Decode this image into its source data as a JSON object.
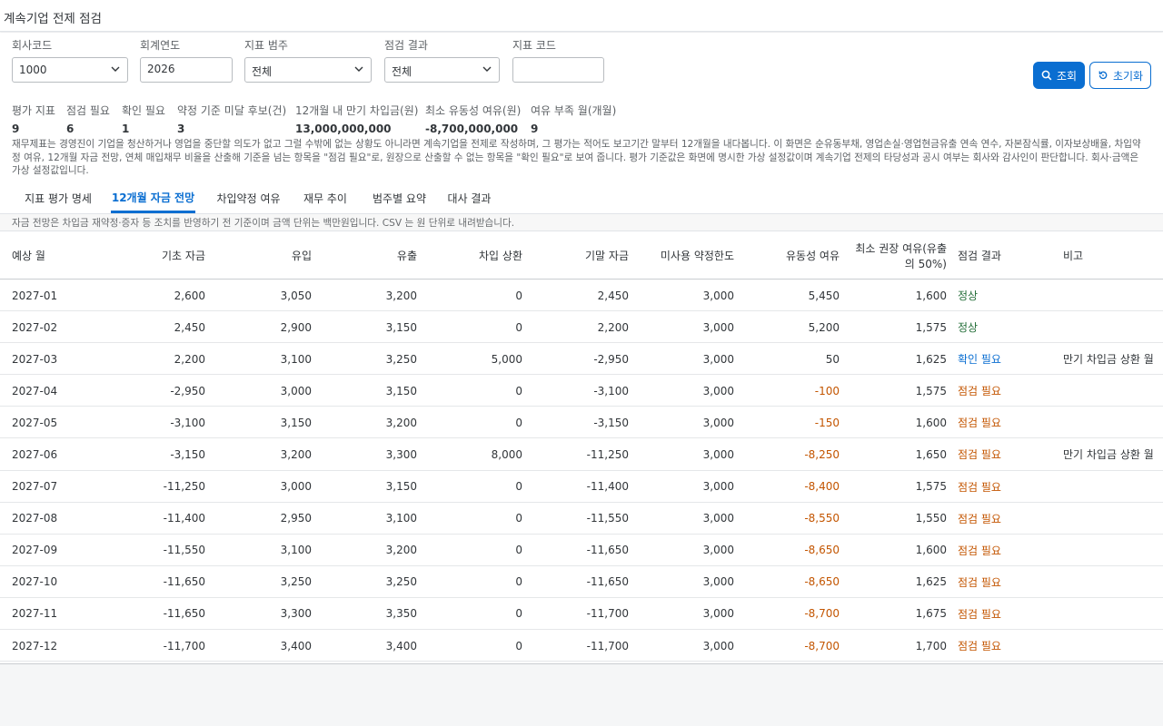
{
  "app_title": "계속기업 전제 점검",
  "filters": {
    "company_code": {
      "label": "회사코드",
      "value": "1000"
    },
    "fiscal_year": {
      "label": "회계연도",
      "value": "2026"
    },
    "indicator_category": {
      "label": "지표 범주",
      "value": "전체"
    },
    "check_result": {
      "label": "점검 결과",
      "value": "전체"
    },
    "indicator_code": {
      "label": "지표 코드",
      "value": ""
    }
  },
  "buttons": {
    "search": "조회",
    "reset": "초기화"
  },
  "kpis": [
    {
      "label": "평가 지표",
      "value": "9"
    },
    {
      "label": "점검 필요",
      "value": "6"
    },
    {
      "label": "확인 필요",
      "value": "1"
    },
    {
      "label": "약정 기준 미달 후보(건)",
      "value": "3"
    },
    {
      "label": "12개월 내 만기 차입금(원)",
      "value": "13,000,000,000"
    },
    {
      "label": "최소 유동성 여유(원)",
      "value": "-8,700,000,000"
    },
    {
      "label": "여유 부족 월(개월)",
      "value": "9"
    }
  ],
  "description": "재무제표는 경영진이 기업을 청산하거나 영업을 중단할 의도가 없고 그럴 수밖에 없는 상황도 아니라면 계속기업을 전제로 작성하며, 그 평가는 적어도 보고기간 말부터 12개월을 내다봅니다. 이 화면은 순유동부채, 영업손실·영업현금유출 연속 연수, 자본잠식률, 이자보상배율, 차입약정 여유, 12개월 자금 전망, 연체 매입채무 비율을 산출해 기준을 넘는 항목을 \"점검 필요\"로, 원장으로 산출할 수 없는 항목을 \"확인 필요\"로 보여 줍니다. 평가 기준값은 화면에 명시한 가상 설정값이며 계속기업 전제의 타당성과 공시 여부는 회사와 감사인이 판단합니다. 회사·금액은 가상 설정값입니다.",
  "tabs": [
    "지표 평가 명세",
    "12개월 자금 전망",
    "차입약정 여유",
    "재무 추이",
    "범주별 요약",
    "대사 결과"
  ],
  "active_tab": 1,
  "table_note": "자금 전망은 차입금 재약정·증자 등 조치를 반영하기 전 기준이며 금액 단위는 백만원입니다. CSV 는 원 단위로 내려받습니다.",
  "columns": [
    "예상 월",
    "기초 자금",
    "유입",
    "유출",
    "차입 상환",
    "기말 자금",
    "미사용 약정한도",
    "유동성 여유",
    "최소 권장 여유(유출의 50%)",
    "점검 결과",
    "비고"
  ],
  "rows": [
    [
      "2027-01",
      "2,600",
      "3,050",
      "3,200",
      "0",
      "2,450",
      "3,000",
      "5,450",
      "1,600",
      "정상",
      ""
    ],
    [
      "2027-02",
      "2,450",
      "2,900",
      "3,150",
      "0",
      "2,200",
      "3,000",
      "5,200",
      "1,575",
      "정상",
      ""
    ],
    [
      "2027-03",
      "2,200",
      "3,100",
      "3,250",
      "5,000",
      "-2,950",
      "3,000",
      "50",
      "1,625",
      "확인 필요",
      "만기 차입금 상환 월"
    ],
    [
      "2027-04",
      "-2,950",
      "3,000",
      "3,150",
      "0",
      "-3,100",
      "3,000",
      "-100",
      "1,575",
      "점검 필요",
      ""
    ],
    [
      "2027-05",
      "-3,100",
      "3,150",
      "3,200",
      "0",
      "-3,150",
      "3,000",
      "-150",
      "1,600",
      "점검 필요",
      ""
    ],
    [
      "2027-06",
      "-3,150",
      "3,200",
      "3,300",
      "8,000",
      "-11,250",
      "3,000",
      "-8,250",
      "1,650",
      "점검 필요",
      "만기 차입금 상환 월"
    ],
    [
      "2027-07",
      "-11,250",
      "3,000",
      "3,150",
      "0",
      "-11,400",
      "3,000",
      "-8,400",
      "1,575",
      "점검 필요",
      ""
    ],
    [
      "2027-08",
      "-11,400",
      "2,950",
      "3,100",
      "0",
      "-11,550",
      "3,000",
      "-8,550",
      "1,550",
      "점검 필요",
      ""
    ],
    [
      "2027-09",
      "-11,550",
      "3,100",
      "3,200",
      "0",
      "-11,650",
      "3,000",
      "-8,650",
      "1,600",
      "점검 필요",
      ""
    ],
    [
      "2027-10",
      "-11,650",
      "3,250",
      "3,250",
      "0",
      "-11,650",
      "3,000",
      "-8,650",
      "1,625",
      "점검 필요",
      ""
    ],
    [
      "2027-11",
      "-11,650",
      "3,300",
      "3,350",
      "0",
      "-11,700",
      "3,000",
      "-8,700",
      "1,675",
      "점검 필요",
      ""
    ],
    [
      "2027-12",
      "-11,700",
      "3,400",
      "3,400",
      "0",
      "-11,700",
      "3,000",
      "-8,700",
      "1,700",
      "점검 필요",
      ""
    ]
  ],
  "colors": {
    "accent": "#0a6ed1",
    "negative": "#c35500",
    "positive": "#256f3a"
  }
}
